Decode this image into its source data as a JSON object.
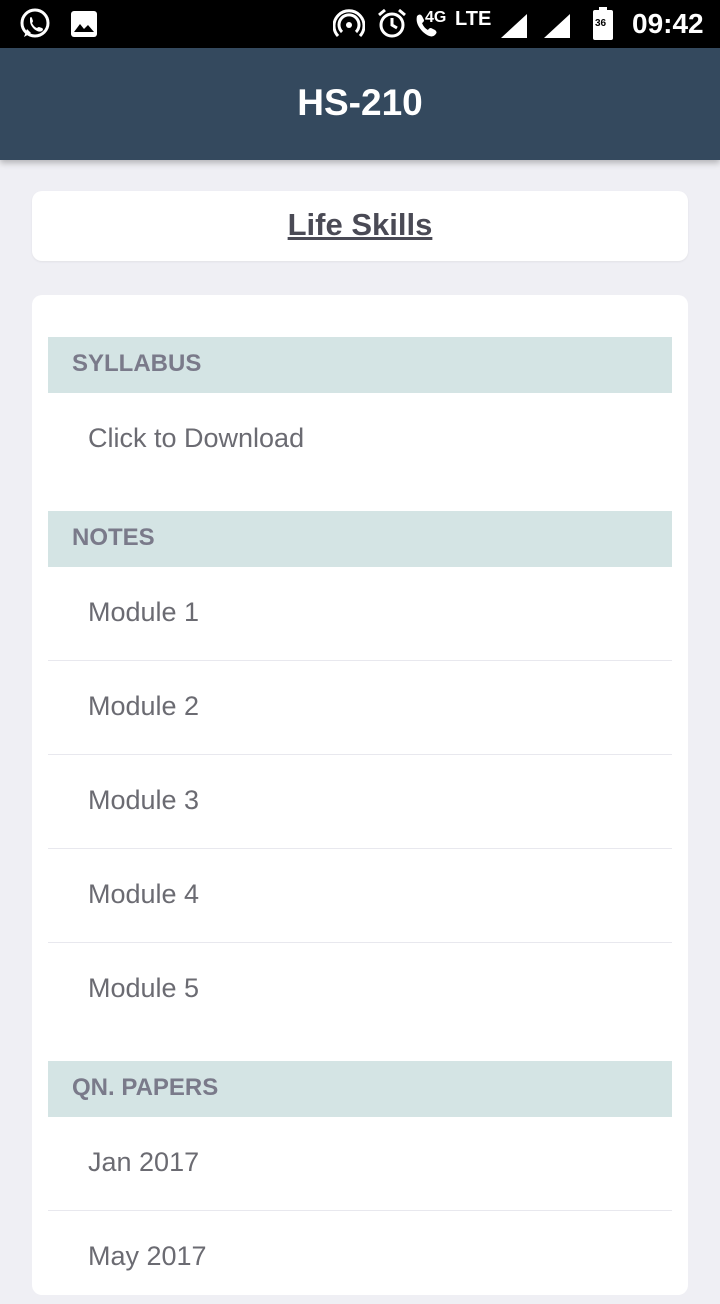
{
  "status_bar": {
    "icons_left": [
      "whatsapp-icon",
      "image-icon"
    ],
    "icons_right": [
      "hotspot-icon",
      "alarm-icon",
      "call-4g-icon",
      "signal-icon",
      "signal-icon",
      "battery-icon"
    ],
    "network_4g": "4G",
    "network_lte": "LTE",
    "battery_level": "36",
    "time": "09:42"
  },
  "app_bar": {
    "title": "HS-210",
    "background": "#34495e"
  },
  "subject": {
    "title": "Life Skills"
  },
  "sections": {
    "syllabus": {
      "header": "SYLLABUS",
      "items": [
        "Click to Download"
      ]
    },
    "notes": {
      "header": "NOTES",
      "items": [
        "Module 1",
        "Module 2",
        "Module 3",
        "Module 4",
        "Module 5"
      ]
    },
    "qn_papers": {
      "header": "QN. PAPERS",
      "items": [
        "Jan 2017",
        "May 2017"
      ]
    }
  },
  "colors": {
    "page_bg": "#efeff4",
    "section_header_bg": "#d4e4e4",
    "section_header_text": "#7a7a8a",
    "item_text": "#6b6b72"
  }
}
